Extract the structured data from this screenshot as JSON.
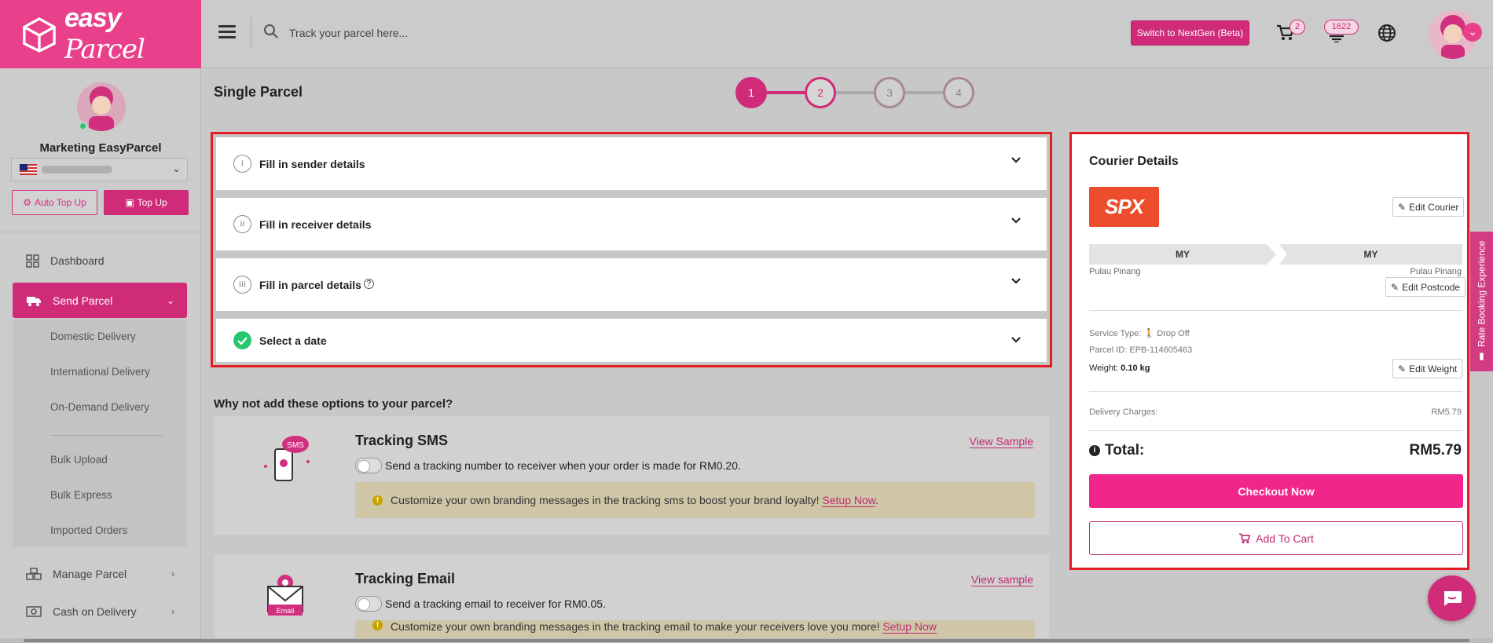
{
  "header": {
    "logo_text": "easy",
    "logo_text2": "Parcel",
    "search_placeholder": "Track your parcel here...",
    "nextgen_label": "Switch to NextGen (Beta)",
    "cart_count": "2",
    "coin_count": "1622"
  },
  "sidebar": {
    "user_name": "Marketing EasyParcel",
    "auto_topup_label": "Auto Top Up",
    "topup_label": "Top Up",
    "nav": {
      "dashboard": "Dashboard",
      "send_parcel": "Send Parcel",
      "manage_parcel": "Manage Parcel",
      "cod": "Cash on Delivery"
    },
    "sub": {
      "domestic": "Domestic Delivery",
      "international": "International Delivery",
      "ondemand": "On-Demand Delivery",
      "bulk_upload": "Bulk Upload",
      "bulk_express": "Bulk Express",
      "imported": "Imported Orders"
    }
  },
  "main": {
    "title": "Single Parcel",
    "steps": [
      "1",
      "2",
      "3",
      "4"
    ],
    "accordion": {
      "sender": {
        "num": "i",
        "label": "Fill in sender details"
      },
      "receiver": {
        "num": "ii",
        "label": "Fill in receiver details"
      },
      "parcel": {
        "num": "iii",
        "label": "Fill in parcel details"
      },
      "date": {
        "label": "Select a date"
      }
    },
    "options_heading": "Why not add these options to your parcel?",
    "sms": {
      "title": "Tracking SMS",
      "view": "View Sample",
      "desc": "Send a tracking number to receiver when your order is made for RM0.20.",
      "note": "Customize your own branding messages in the tracking sms to boost your brand loyalty!",
      "note_link": "Setup Now",
      "icon_text": "SMS"
    },
    "email": {
      "title": "Tracking Email",
      "view": "View sample",
      "desc": "Send a tracking email to receiver for RM0.05.",
      "note": "Customize your own branding messages in the tracking email to make your receivers love you more!",
      "note_link": "Setup Now",
      "icon_text": "Email"
    }
  },
  "courier": {
    "title": "Courier Details",
    "logo_text": "SPX",
    "edit_courier": "Edit Courier",
    "from_country": "MY",
    "to_country": "MY",
    "from_city": "Pulau Pinang",
    "to_city": "Pulau Pinang",
    "edit_postcode": "Edit Postcode",
    "service_type_label": "Service Type:",
    "service_type_value": "Drop Off",
    "parcel_id_label": "Parcel ID:",
    "parcel_id_value": "EPB-114605463",
    "weight_label": "Weight:",
    "weight_value": "0.10 kg",
    "edit_weight": "Edit Weight",
    "charges_label": "Delivery Charges:",
    "charges_value": "RM5.79",
    "total_label": "Total:",
    "total_value": "RM5.79",
    "checkout": "Checkout Now",
    "add_to_cart": "Add To Cart"
  },
  "side_tab": "Rate Booking Experience",
  "colors": {
    "brand": "#e8408a",
    "highlight": "#e31c25",
    "success": "#28c76f",
    "spx": "#ee4d2d"
  }
}
